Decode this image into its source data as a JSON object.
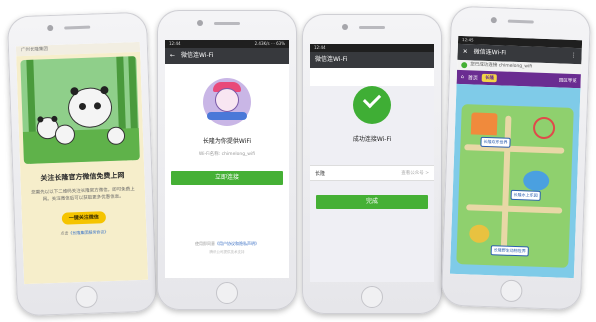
{
  "screens": {
    "follow": {
      "top_title": "广州长隆集团",
      "title": "关注长隆官方微信免费上网",
      "description": "您需先以以下二维码关注长隆官方微信，即可免费上网。关注微信后可以获取更多优惠信息。",
      "button": "一键关注微信",
      "footer_prefix": "点击",
      "footer_link": "《长隆集团服务协议》"
    },
    "connect": {
      "status_time": "12:44",
      "status_right": "2.43K/s  ⋯  63%",
      "back_icon": "back-arrow-icon",
      "bar_title": "微信连Wi-Fi",
      "provider_text": "长隆为你提供WiFi",
      "ssid_text": "Wi-Fi名称: chimelong_wifi",
      "button": "立即连接",
      "footer_prefix": "使用即同意",
      "footer_link": "《用户协议和隐私声明》",
      "footer_note": "腾讯公司提供技术支持"
    },
    "success": {
      "status_time": "12:44",
      "bar_title": "微信连Wi-Fi",
      "title": "成功连接Wi-Fi",
      "row_label": "长隆",
      "row_action": "查看公众号 >",
      "button": "完成"
    },
    "park": {
      "status_time": "12:45",
      "bar_title": "微信连Wi-Fi",
      "notice": "您已成功连接 chimelong_wifi",
      "nav_home": "首页",
      "nav_logo": "长隆",
      "nav_menu": "园区导览",
      "sign_1": "长隆欢乐世界",
      "sign_2": "长隆水上乐园",
      "sign_3": "长隆野生动物世界"
    }
  },
  "colors": {
    "wechat_green": "#45b035",
    "park_purple": "#6a2c91",
    "follow_button": "#f5c400"
  }
}
